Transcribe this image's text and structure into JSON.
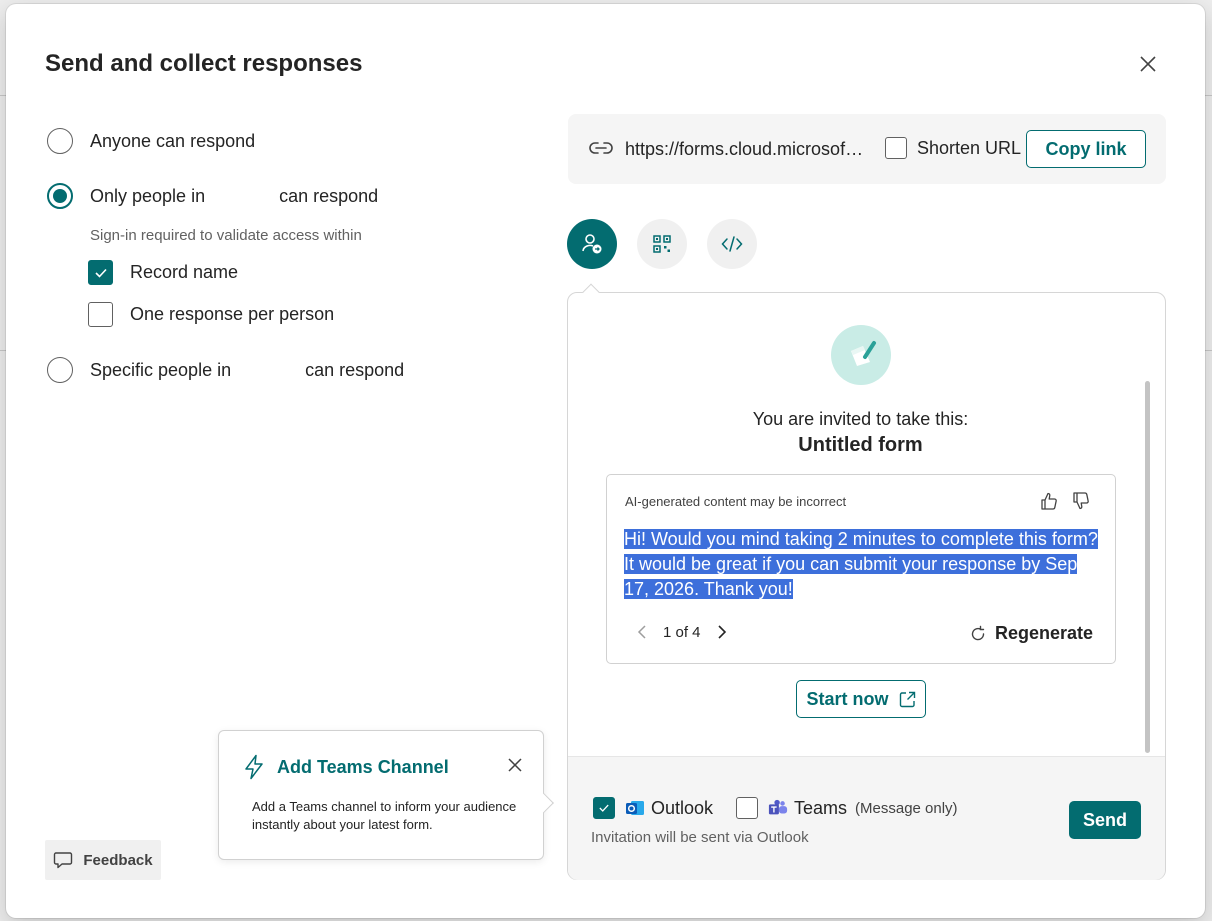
{
  "dialog": {
    "title": "Send and collect responses"
  },
  "permissions": {
    "anyone_label": "Anyone can respond",
    "only_people_prefix": "Only people in",
    "only_people_suffix": "can respond",
    "signin_hint": "Sign-in required to validate access within",
    "record_name_label": "Record name",
    "record_name_checked": true,
    "one_response_label": "One response per person",
    "one_response_checked": false,
    "specific_prefix": "Specific people in",
    "specific_suffix": "can respond",
    "selected_option": "only_people"
  },
  "link_bar": {
    "url": "https://forms.cloud.microsoft...",
    "shorten_label": "Shorten URL",
    "shorten_checked": false,
    "copy_label": "Copy link"
  },
  "share_tabs": [
    {
      "icon": "person-send-icon",
      "active": true
    },
    {
      "icon": "qr-code-icon",
      "active": false
    },
    {
      "icon": "embed-code-icon",
      "active": false
    }
  ],
  "preview": {
    "invited_text": "You are invited to take this:",
    "form_name": "Untitled form",
    "ai_note": "AI-generated content may be incorrect",
    "ai_message": "Hi! Would you mind taking 2 minutes to complete this form? It would be great if you can submit your response by Sep 17, 2026. Thank you!",
    "pager_text": "1 of 4",
    "regenerate_label": "Regenerate",
    "start_label": "Start now"
  },
  "footer": {
    "outlook_label": "Outlook",
    "outlook_checked": true,
    "teams_label": "Teams",
    "teams_checked": false,
    "teams_note": "(Message only)",
    "via_text": "Invitation will be sent via Outlook",
    "send_label": "Send"
  },
  "teaching_bubble": {
    "title": "Add Teams Channel",
    "body": "Add a Teams channel to inform your audience instantly about your latest form."
  },
  "feedback_label": "Feedback",
  "colors": {
    "accent": "#036c70",
    "selection": "#3d6fdb"
  }
}
